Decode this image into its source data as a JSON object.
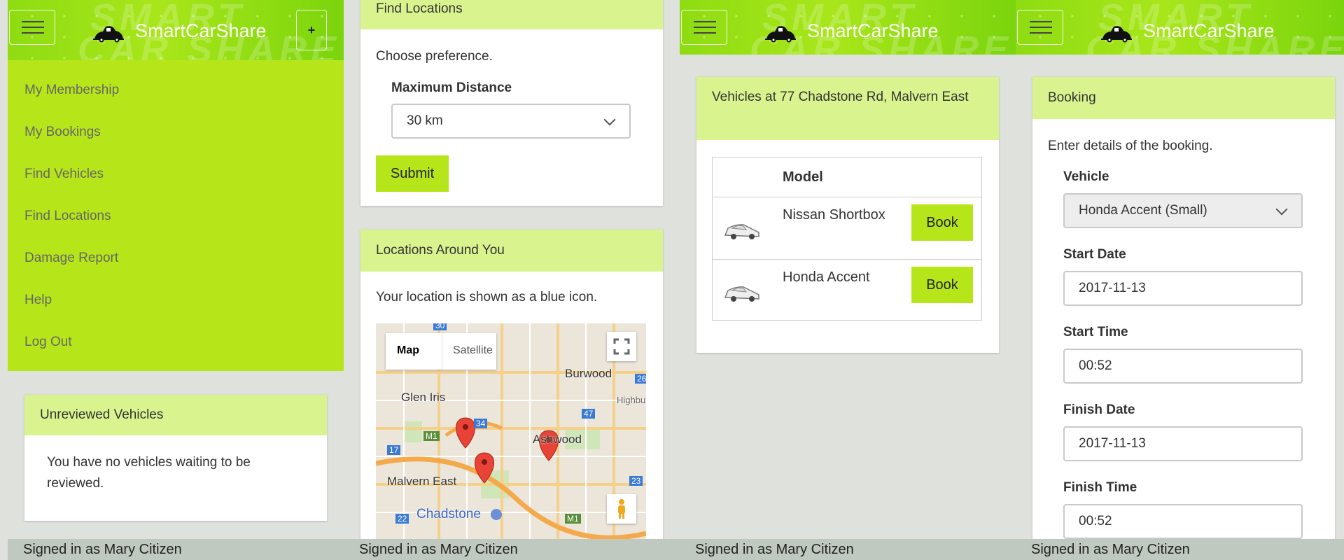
{
  "app": {
    "brand": "SmartCarShare",
    "watermark_top": "SMART",
    "watermark_bottom": "CAR  SHARE",
    "signed_in": "Signed in as Mary Citizen",
    "accent": "#b6e61a",
    "panel_head_color": "#d9f48e"
  },
  "screen1": {
    "plus_label": "+",
    "nav": [
      "My Membership",
      "My Bookings",
      "Find Vehicles",
      "Find Locations",
      "Damage Report",
      "Help",
      "Log Out"
    ],
    "unreviewed": {
      "title": "Unreviewed Vehicles",
      "message": "You have no vehicles waiting to be reviewed."
    }
  },
  "screen2": {
    "find_locations": {
      "title": "Find Locations",
      "intro": "Choose preference.",
      "distance_label": "Maximum Distance",
      "distance_value": "30 km",
      "submit_label": "Submit"
    },
    "locations_around": {
      "title": "Locations Around You",
      "intro": "Your location is shown as a blue icon.",
      "map_tab": "Map",
      "satellite_tab": "Satellite",
      "places": [
        "Burwood",
        "Glen Iris",
        "Highbu",
        "Ashwood",
        "Malvern East",
        "Chadstone"
      ],
      "route_badges": [
        "30",
        "26",
        "34",
        "47",
        "M1",
        "17",
        "23",
        "22",
        "M1"
      ]
    }
  },
  "screen3": {
    "vehicles": {
      "title": "Vehicles at 77 Chadstone Rd, Malvern East",
      "model_header": "Model",
      "rows": [
        {
          "model": "Nissan Shortbox",
          "button": "Book"
        },
        {
          "model": "Honda Accent",
          "button": "Book"
        }
      ]
    }
  },
  "screen4": {
    "booking": {
      "title": "Booking",
      "intro": "Enter details of the booking.",
      "vehicle_label": "Vehicle",
      "vehicle_value": "Honda Accent (Small)",
      "start_date_label": "Start Date",
      "start_date": "2017-11-13",
      "start_time_label": "Start Time",
      "start_time": "00:52",
      "finish_date_label": "Finish Date",
      "finish_date": "2017-11-13",
      "finish_time_label": "Finish Time",
      "finish_time": "00:52"
    }
  }
}
